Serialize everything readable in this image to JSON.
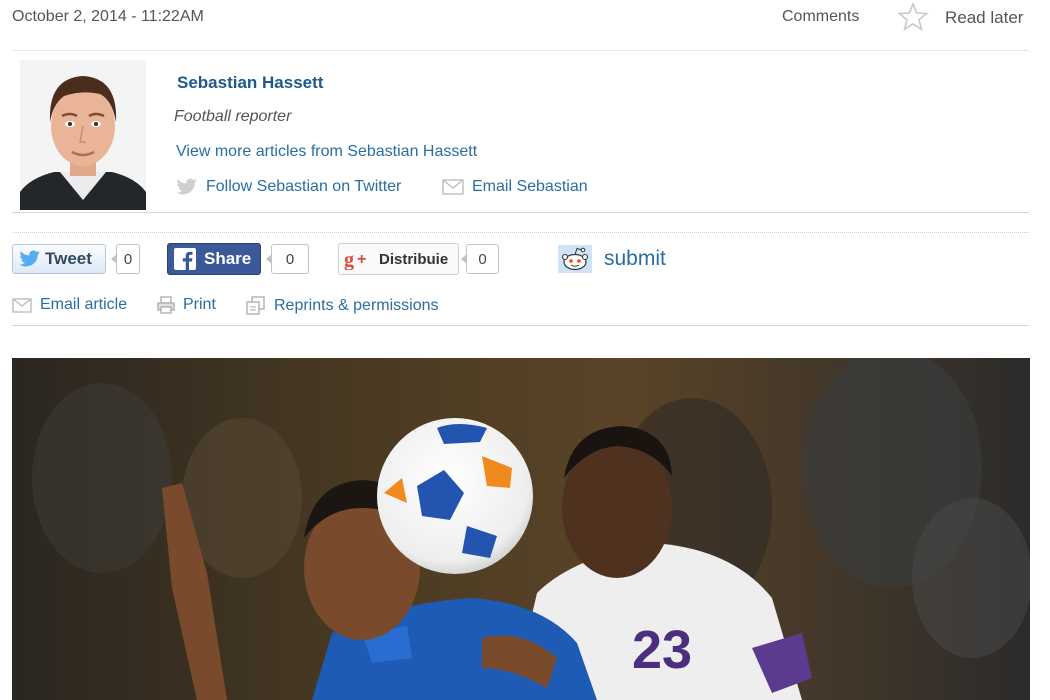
{
  "article": {
    "timestamp": "October 2, 2014 - 11:22AM",
    "comments_label": "Comments",
    "read_later_label": "Read later"
  },
  "author": {
    "name": "Sebastian Hassett",
    "role": "Football reporter",
    "more_articles": "View more articles from Sebastian Hassett",
    "twitter": "Follow Sebastian on Twitter",
    "email": "Email Sebastian"
  },
  "social": {
    "tweet_label": "Tweet",
    "tweet_count": "0",
    "share_label": "Share",
    "share_count": "0",
    "gplus_label": "Distribuie",
    "gplus_count": "0",
    "reddit_label": "submit"
  },
  "tools": {
    "email_article": "Email article",
    "print": "Print",
    "reprints": "Reprints & permissions"
  },
  "icons": {
    "star": "star-icon",
    "twitter": "twitter-bird-icon",
    "email": "envelope-icon",
    "facebook": "facebook-icon",
    "gplus": "google-plus-icon",
    "reddit": "reddit-alien-icon",
    "print": "printer-icon",
    "reprints": "reprints-icon"
  },
  "colors": {
    "link": "#2a6da2",
    "facebook": "#3b5998",
    "gplus": "#dd4b39",
    "twitter": "#55acee"
  }
}
